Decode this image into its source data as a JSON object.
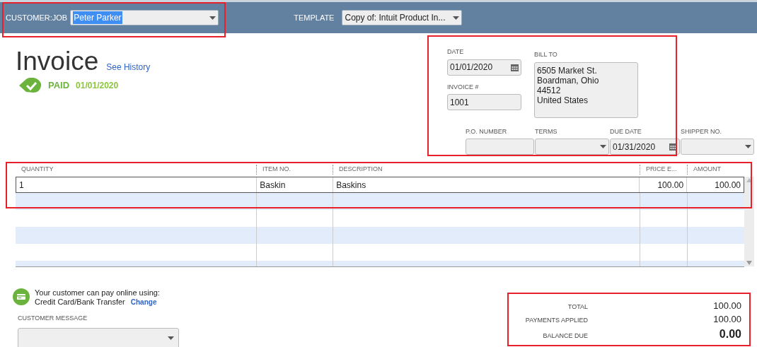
{
  "header": {
    "customer_job": {
      "label": "CUSTOMER:JOB",
      "value": "Peter Parker",
      "highlighted": true
    },
    "template": {
      "label": "TEMPLATE",
      "value": "Copy of: Intuit Product In..."
    }
  },
  "invoice": {
    "title": "Invoice",
    "history_link": "See History",
    "status": {
      "label": "PAID",
      "date": "01/01/2020"
    }
  },
  "fields": {
    "date": {
      "label": "DATE",
      "value": "01/01/2020"
    },
    "invoice_number": {
      "label": "INVOICE #",
      "value": "1001"
    },
    "bill_to": {
      "label": "BILL TO",
      "lines": [
        "6505 Market St.",
        "Boardman, Ohio",
        "44512",
        "United States"
      ]
    },
    "po_number": {
      "label": "P.O. NUMBER"
    },
    "terms": {
      "label": "TERMS"
    },
    "due_date": {
      "label": "DUE DATE",
      "value": "01/31/2020"
    },
    "shipper_no": {
      "label": "SHIPPER NO."
    }
  },
  "table": {
    "columns": [
      "QUANTITY",
      "ITEM NO.",
      "DESCRIPTION",
      "PRICE E...",
      "AMOUNT"
    ],
    "rows": [
      {
        "cells": [
          "1",
          "Baskin",
          "Baskins",
          "100.00",
          "100.00"
        ],
        "selected": true
      }
    ]
  },
  "payment": {
    "message": "Your customer can pay online using:",
    "methods": "Credit Card/Bank Transfer",
    "change_link": "Change"
  },
  "customer_message": {
    "label": "CUSTOMER MESSAGE"
  },
  "totals": [
    {
      "label": "TOTAL",
      "value": "100.00",
      "kind": "normal"
    },
    {
      "label": "PAYMENTS APPLIED",
      "value": "100.00",
      "kind": "normal"
    },
    {
      "label": "BALANCE DUE",
      "value": "0.00",
      "kind": "emphasis"
    }
  ]
}
